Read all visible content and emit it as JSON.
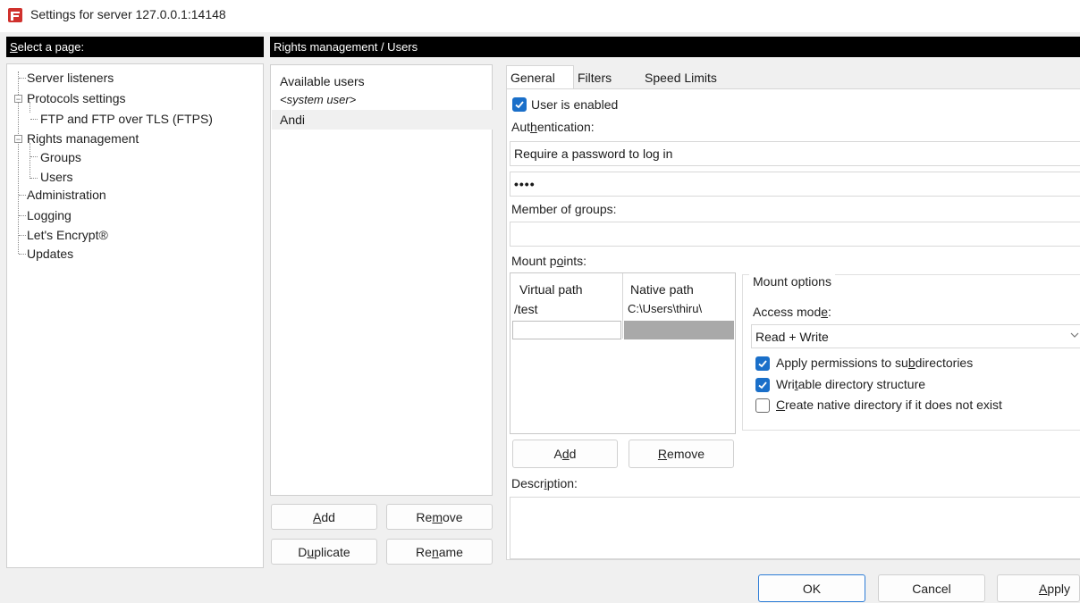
{
  "window": {
    "title": "Settings for server 127.0.0.1:14148"
  },
  "colors": {
    "accent": "#1a6fc9",
    "header_bg": "#000000",
    "selected_row": "#f0f0f0",
    "native_cell_selected": "#a9a9a9"
  },
  "left": {
    "header": "Select a page:",
    "tree": [
      {
        "label": "Server listeners"
      },
      {
        "label": "Protocols settings"
      },
      {
        "label": "FTP and FTP over TLS (FTPS)"
      },
      {
        "label": "Rights management"
      },
      {
        "label": "Groups"
      },
      {
        "label": "Users"
      },
      {
        "label": "Administration"
      },
      {
        "label": "Logging"
      },
      {
        "label": "Let's Encrypt®"
      },
      {
        "label": "Updates"
      }
    ]
  },
  "users": {
    "header": "Rights management / Users",
    "list_title": "Available users",
    "items": [
      "<system user>",
      "Andi"
    ],
    "selected": "Andi",
    "buttons": {
      "add": "Add",
      "remove": "Remove",
      "duplicate": "Duplicate",
      "rename": "Rename"
    }
  },
  "tabs": [
    "General",
    "Filters",
    "Speed Limits"
  ],
  "general": {
    "user_enabled_label": "User is enabled",
    "user_enabled": true,
    "auth_label": "Authentication:",
    "auth_value": "Require a password to log in",
    "password_value": "••••",
    "groups_label": "Member of groups:",
    "groups_value": "",
    "mount_label": "Mount points:",
    "mount_columns": [
      "Virtual path",
      "Native path"
    ],
    "mount_rows": [
      {
        "virtual": "/test",
        "native": "C:\\Users\\thiru\\"
      },
      {
        "virtual": "",
        "native": ""
      }
    ],
    "mount_add": "Add",
    "mount_remove": "Remove",
    "mount_options": {
      "title": "Mount options",
      "access_mode_label": "Access mode:",
      "access_mode_value": "Read + Write",
      "apply_permissions": "Apply permissions to subdirectories",
      "apply_permissions_checked": true,
      "writable": "Writable directory structure",
      "writable_checked": true,
      "create_native": "Create native directory if it does not exist",
      "create_native_checked": false
    },
    "description_label": "Description:",
    "description_value": ""
  },
  "footer": {
    "ok": "OK",
    "cancel": "Cancel",
    "apply": "Apply"
  }
}
